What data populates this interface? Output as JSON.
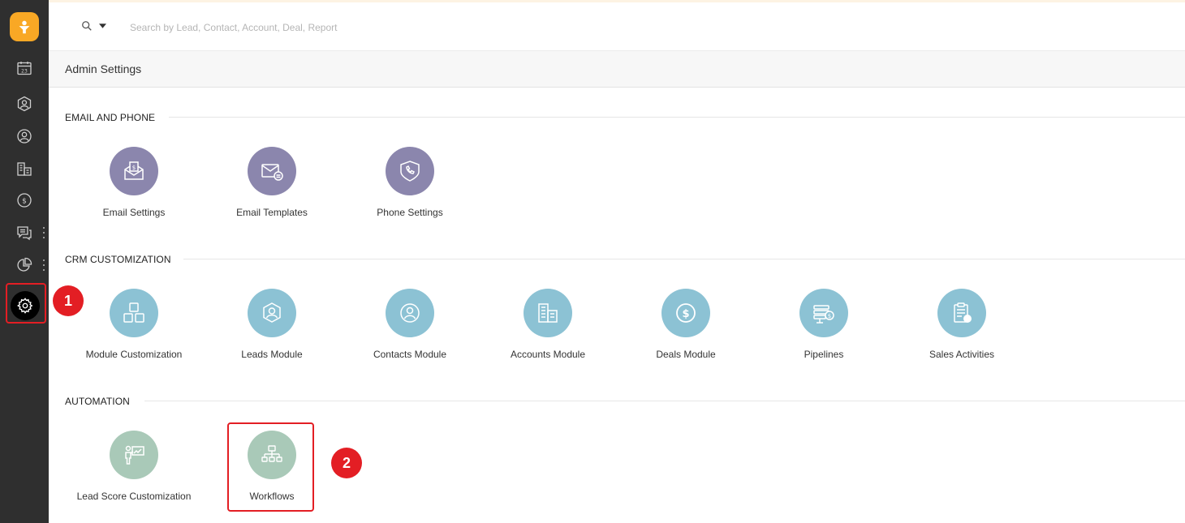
{
  "search": {
    "placeholder": "Search by Lead, Contact, Account, Deal, Report"
  },
  "header": {
    "title": "Admin Settings"
  },
  "sidebar": {
    "items": [
      {
        "icon": "calendar-icon"
      },
      {
        "icon": "lead-icon"
      },
      {
        "icon": "contact-icon"
      },
      {
        "icon": "accounts-icon"
      },
      {
        "icon": "deals-icon"
      },
      {
        "icon": "chat-icon"
      },
      {
        "icon": "reports-icon"
      },
      {
        "icon": "gear-icon"
      }
    ]
  },
  "annotations": {
    "step1": "1",
    "step2": "2"
  },
  "sections": {
    "email_phone": {
      "title": "EMAIL AND PHONE",
      "tiles": [
        "Email Settings",
        "Email Templates",
        "Phone Settings"
      ]
    },
    "crm": {
      "title": "CRM CUSTOMIZATION",
      "tiles": [
        "Module Customization",
        "Leads Module",
        "Contacts Module",
        "Accounts Module",
        "Deals Module",
        "Pipelines",
        "Sales Activities"
      ]
    },
    "automation": {
      "title": "AUTOMATION",
      "tiles": [
        "Lead Score Customization",
        "Workflows"
      ]
    }
  },
  "colors": {
    "sidebar": "#2f2f2f",
    "logo": "#f9a825",
    "email_tiles": "#8b86ad",
    "crm_tiles": "#8cc2d4",
    "automation_tiles": "#a9c9b8",
    "highlight": "#e31e24"
  }
}
